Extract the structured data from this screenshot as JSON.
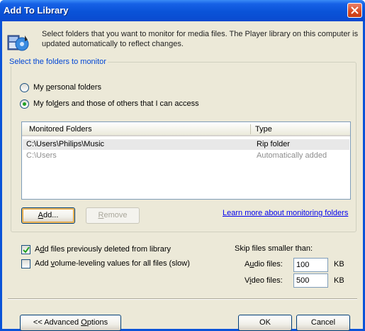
{
  "window": {
    "title": "Add To Library"
  },
  "intro": {
    "icon": "media-library-icon",
    "text": "Select folders that you want to monitor for media files. The Player library on this computer is updated automatically to reflect changes."
  },
  "group": {
    "legend": "Select the folders to monitor",
    "radio_personal": "My personal folders",
    "radio_all": "My folders and those of others that I can access",
    "selected_option": "My folders and those of others that I can access"
  },
  "table": {
    "columns": [
      "Monitored Folders",
      "Type"
    ],
    "rows": [
      {
        "folder": "C:\\Users\\Philips\\Music",
        "type": "Rip folder"
      },
      {
        "folder": "C:\\Users",
        "type": "Automatically added"
      }
    ]
  },
  "buttons": {
    "add": "Add...",
    "remove": "Remove",
    "advanced": "<< Advanced Options",
    "ok": "OK",
    "cancel": "Cancel"
  },
  "learn_more": "Learn more about monitoring folders",
  "options": {
    "add_deleted": {
      "label": "Add files previously deleted from library",
      "checked": true
    },
    "volume_leveling": {
      "label": "Add volume-leveling values for all files (slow)",
      "checked": false
    }
  },
  "skip": {
    "heading": "Skip files smaller than:",
    "audio_label": "Audio files:",
    "audio_value": "100",
    "video_label": "Video files:",
    "video_value": "500",
    "unit": "KB"
  },
  "colors": {
    "title_bar": "#0a53d8",
    "dialog_bg": "#ece9d8",
    "link": "#0000ee",
    "legend": "#0046d5"
  }
}
